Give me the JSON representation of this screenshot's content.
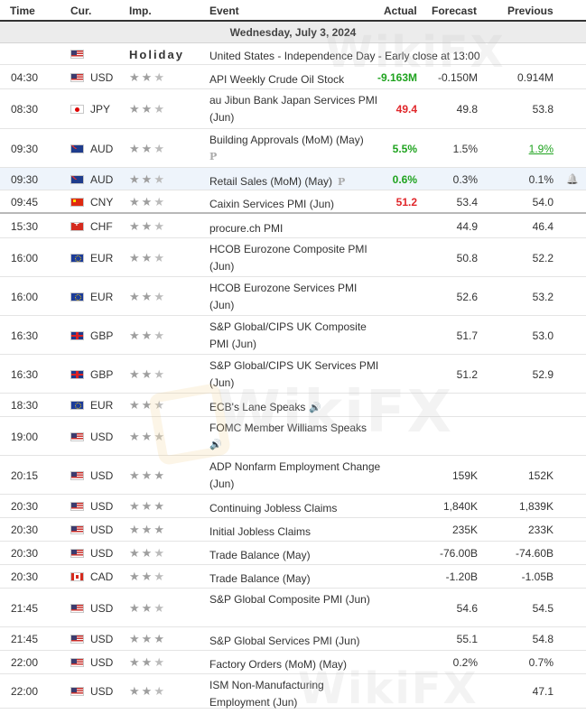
{
  "header": {
    "time": "Time",
    "cur": "Cur.",
    "imp": "Imp.",
    "event": "Event",
    "actual": "Actual",
    "forecast": "Forecast",
    "previous": "Previous"
  },
  "date_label": "Wednesday, July 3, 2024",
  "colors": {
    "positive": "#1fa31f",
    "negative": "#e0272b",
    "highlight_row": "#eef4fb",
    "date_bar": "#ececec"
  },
  "rows": [
    {
      "time": "",
      "flag": "us",
      "cur": "",
      "stars": 0,
      "imp_label": "Holiday",
      "event": "United States - Independence Day - Early close at 13:00",
      "actual": "",
      "actual_color": "",
      "forecast": "",
      "previous": "",
      "previous_color": ""
    },
    {
      "time": "04:30",
      "flag": "us",
      "cur": "USD",
      "stars": 2,
      "event": "API Weekly Crude Oil Stock",
      "actual": "-9.163M",
      "actual_color": "green",
      "forecast": "-0.150M",
      "previous": "0.914M",
      "previous_color": ""
    },
    {
      "time": "08:30",
      "flag": "jp",
      "cur": "JPY",
      "stars": 2,
      "event": "au Jibun Bank Japan Services PMI (Jun)",
      "actual": "49.4",
      "actual_color": "red",
      "forecast": "49.8",
      "previous": "53.8",
      "previous_color": ""
    },
    {
      "time": "09:30",
      "flag": "au",
      "cur": "AUD",
      "stars": 2,
      "event": "Building Approvals (MoM) (May)",
      "event_mark": "P",
      "actual": "5.5%",
      "actual_color": "green",
      "forecast": "1.5%",
      "previous": "1.9%",
      "previous_color": "green"
    },
    {
      "time": "09:30",
      "flag": "au",
      "cur": "AUD",
      "stars": 2,
      "event": "Retail Sales (MoM) (May)",
      "event_mark": "P",
      "actual": "0.6%",
      "actual_color": "green",
      "forecast": "0.3%",
      "previous": "0.1%",
      "previous_color": "",
      "alert": true
    },
    {
      "time": "09:45",
      "flag": "cn",
      "cur": "CNY",
      "stars": 2,
      "event": "Caixin Services PMI (Jun)",
      "actual": "51.2",
      "actual_color": "red",
      "forecast": "53.4",
      "previous": "54.0",
      "previous_color": ""
    },
    {
      "time": "15:30",
      "flag": "ch",
      "cur": "CHF",
      "stars": 2,
      "event": "procure.ch PMI",
      "actual": "",
      "actual_color": "",
      "forecast": "44.9",
      "previous": "46.4",
      "previous_color": ""
    },
    {
      "time": "16:00",
      "flag": "eu",
      "cur": "EUR",
      "stars": 2,
      "event": "HCOB Eurozone Composite PMI (Jun)",
      "actual": "",
      "actual_color": "",
      "forecast": "50.8",
      "previous": "52.2",
      "previous_color": ""
    },
    {
      "time": "16:00",
      "flag": "eu",
      "cur": "EUR",
      "stars": 2,
      "event": "HCOB Eurozone Services PMI (Jun)",
      "actual": "",
      "actual_color": "",
      "forecast": "52.6",
      "previous": "53.2",
      "previous_color": ""
    },
    {
      "time": "16:30",
      "flag": "gb",
      "cur": "GBP",
      "stars": 2,
      "event": "S&P Global/CIPS UK Composite PMI (Jun)",
      "actual": "",
      "actual_color": "",
      "forecast": "51.7",
      "previous": "53.0",
      "previous_color": ""
    },
    {
      "time": "16:30",
      "flag": "gb",
      "cur": "GBP",
      "stars": 2,
      "event": "S&P Global/CIPS UK Services PMI (Jun)",
      "actual": "",
      "actual_color": "",
      "forecast": "51.2",
      "previous": "52.9",
      "previous_color": ""
    },
    {
      "time": "18:30",
      "flag": "eu",
      "cur": "EUR",
      "stars": 2,
      "event": "ECB's Lane Speaks",
      "speaker": true,
      "actual": "",
      "actual_color": "",
      "forecast": "",
      "previous": "",
      "previous_color": ""
    },
    {
      "time": "19:00",
      "flag": "us",
      "cur": "USD",
      "stars": 2,
      "event": "FOMC Member Williams Speaks",
      "speaker": true,
      "speaker_newline": true,
      "actual": "",
      "actual_color": "",
      "forecast": "",
      "previous": "",
      "previous_color": ""
    },
    {
      "time": "20:15",
      "flag": "us",
      "cur": "USD",
      "stars": 3,
      "event": "ADP Nonfarm Employment Change (Jun)",
      "actual": "",
      "actual_color": "",
      "forecast": "159K",
      "previous": "152K",
      "previous_color": ""
    },
    {
      "time": "20:30",
      "flag": "us",
      "cur": "USD",
      "stars": 3,
      "event": "Continuing Jobless Claims",
      "actual": "",
      "actual_color": "",
      "forecast": "1,840K",
      "previous": "1,839K",
      "previous_color": ""
    },
    {
      "time": "20:30",
      "flag": "us",
      "cur": "USD",
      "stars": 3,
      "event": "Initial Jobless Claims",
      "actual": "",
      "actual_color": "",
      "forecast": "235K",
      "previous": "233K",
      "previous_color": ""
    },
    {
      "time": "20:30",
      "flag": "us",
      "cur": "USD",
      "stars": 2,
      "event": "Trade Balance (May)",
      "actual": "",
      "actual_color": "",
      "forecast": "-76.00B",
      "previous": "-74.60B",
      "previous_color": ""
    },
    {
      "time": "20:30",
      "flag": "ca",
      "cur": "CAD",
      "stars": 2,
      "event": "Trade Balance (May)",
      "actual": "",
      "actual_color": "",
      "forecast": "-1.20B",
      "previous": "-1.05B",
      "previous_color": ""
    },
    {
      "time": "21:45",
      "flag": "us",
      "cur": "USD",
      "stars": 2,
      "event": "S&P Global Composite PMI (Jun)",
      "actual": "",
      "actual_color": "",
      "forecast": "54.6",
      "previous": "54.5",
      "previous_color": ""
    },
    {
      "time": "21:45",
      "flag": "us",
      "cur": "USD",
      "stars": 3,
      "event": "S&P Global Services PMI (Jun)",
      "actual": "",
      "actual_color": "",
      "forecast": "55.1",
      "previous": "54.8",
      "previous_color": ""
    },
    {
      "time": "22:00",
      "flag": "us",
      "cur": "USD",
      "stars": 2,
      "event": "Factory Orders (MoM) (May)",
      "actual": "",
      "actual_color": "",
      "forecast": "0.2%",
      "previous": "0.7%",
      "previous_color": ""
    },
    {
      "time": "22:00",
      "flag": "us",
      "cur": "USD",
      "stars": 2,
      "event": "ISM Non-Manufacturing Employment (Jun)",
      "actual": "",
      "actual_color": "",
      "forecast": "",
      "previous": "47.1",
      "previous_color": ""
    }
  ],
  "watermark": "WikiFX",
  "icons": {
    "star": "star-icon",
    "speaker": "speaker-icon",
    "alert": "bell-plus-icon",
    "preliminary": "p-mark-icon"
  }
}
